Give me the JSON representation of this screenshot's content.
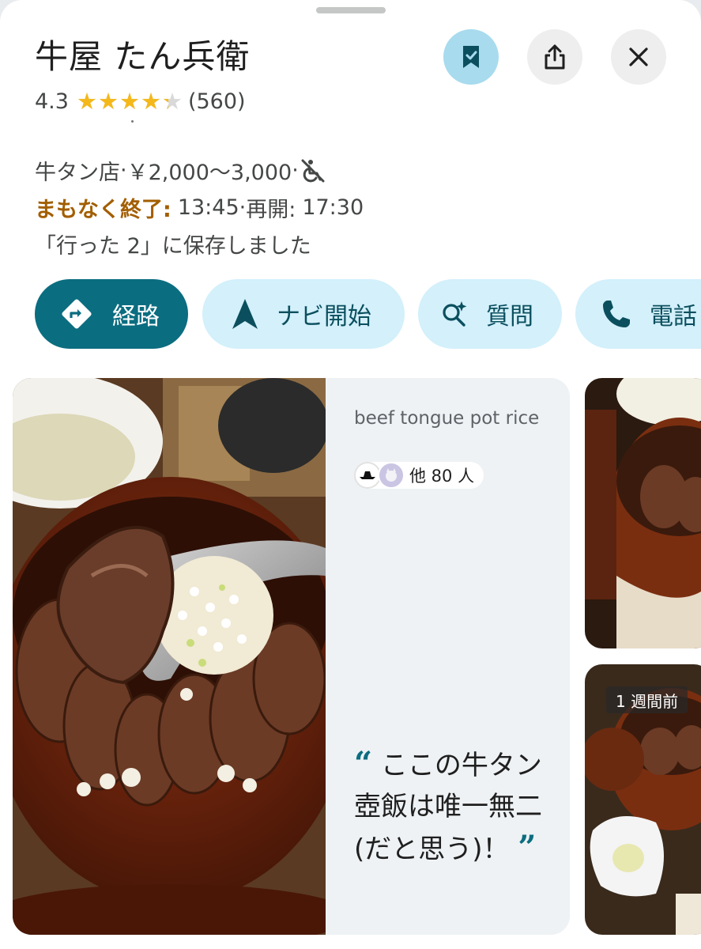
{
  "place": {
    "name": "牛屋 たん兵衛",
    "rating": "4.3",
    "rating_fraction": 0.86,
    "review_count": "(560)",
    "category": "牛タン店",
    "separator": " · ",
    "price_range": "￥2,000〜3,000",
    "status_label": "まもなく終了:",
    "closing_time": "13:45",
    "reopen_label": "再開:",
    "reopen_time": "17:30",
    "saved_note": "「行った 2」に保存しました"
  },
  "header_actions": {
    "save_icon": "bookmark-icon",
    "share_icon": "share-icon",
    "close_icon": "close-icon"
  },
  "action_chips": [
    {
      "label": "経路",
      "icon": "directions-icon"
    },
    {
      "label": "ナビ開始",
      "icon": "navigation-arrow-icon"
    },
    {
      "label": "質問",
      "icon": "ask-sparkle-icon"
    },
    {
      "label": "電話",
      "icon": "phone-icon"
    }
  ],
  "featured_dish": {
    "name": "beef tongue pot rice",
    "contributors": "他 80 人",
    "quote": "ここの牛タン壺飯は唯一無二(だと思う)！",
    "open_quote": "“",
    "close_quote": "”"
  },
  "thumbnails": [
    {
      "badge": ""
    },
    {
      "badge": "1 週間前"
    }
  ],
  "colors": {
    "accent": "#0b6d80",
    "chip_bg": "#d3f0fb",
    "save_bg": "#a8dbee",
    "closing": "#a25e00",
    "star": "#f5b81b"
  }
}
